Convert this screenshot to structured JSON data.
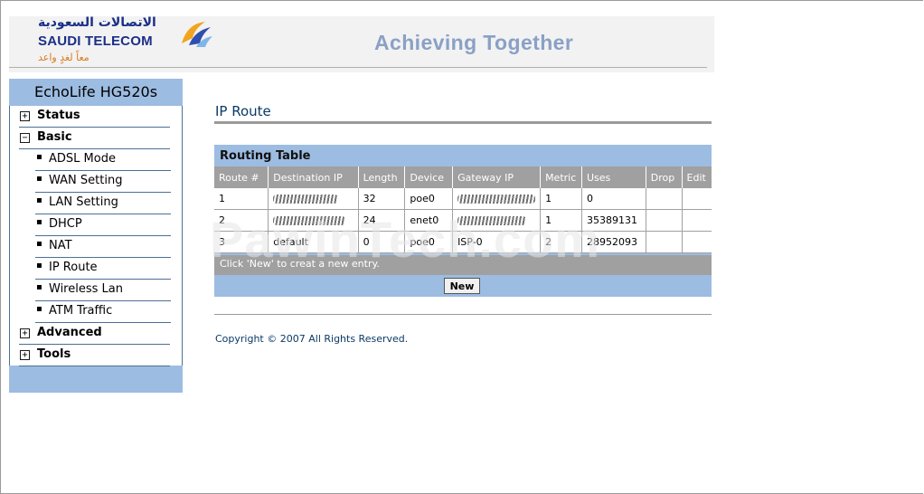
{
  "header": {
    "logo_arabic": "الاتصالات السعودية",
    "logo_english": "SAUDI TELECOM",
    "logo_sub": "معاً لغدٍ واعد",
    "tagline": "Achieving Together"
  },
  "sidebar": {
    "title": "EchoLife HG520s",
    "items": [
      {
        "label": "Status",
        "icon": "plus"
      },
      {
        "label": "Basic",
        "icon": "minus"
      },
      {
        "label": "ADSL Mode"
      },
      {
        "label": "WAN Setting"
      },
      {
        "label": "LAN Setting"
      },
      {
        "label": "DHCP"
      },
      {
        "label": "NAT"
      },
      {
        "label": "IP Route"
      },
      {
        "label": "Wireless Lan"
      },
      {
        "label": "ATM Traffic"
      },
      {
        "label": "Advanced",
        "icon": "plus"
      },
      {
        "label": "Tools",
        "icon": "plus"
      }
    ]
  },
  "main": {
    "title": "IP Route",
    "table_caption": "Routing Table",
    "columns": [
      "Route #",
      "Destination IP",
      "Length",
      "Device",
      "Gateway IP",
      "Metric",
      "Uses",
      "Drop",
      "Edit"
    ],
    "rows": [
      {
        "route": "1",
        "dest": "",
        "length": "32",
        "device": "poe0",
        "gateway": "",
        "metric": "1",
        "uses": "0"
      },
      {
        "route": "2",
        "dest": "",
        "length": "24",
        "device": "enet0",
        "gateway": "",
        "metric": "1",
        "uses": "35389131"
      },
      {
        "route": "3",
        "dest": "default",
        "length": "0",
        "device": "poe0",
        "gateway": "ISP-0",
        "metric": "2",
        "uses": "28952093"
      }
    ],
    "hint": "Click 'New' to creat a new entry.",
    "new_button": "New",
    "copyright": "Copyright © 2007 All Rights Reserved."
  },
  "watermark": "PawinTech.com",
  "colors": {
    "brand_blue": "#1b2f88",
    "sidebar_blue": "#9dbce1",
    "table_header_gray": "#a0a0a0",
    "tagline": "#8aa0c6"
  }
}
